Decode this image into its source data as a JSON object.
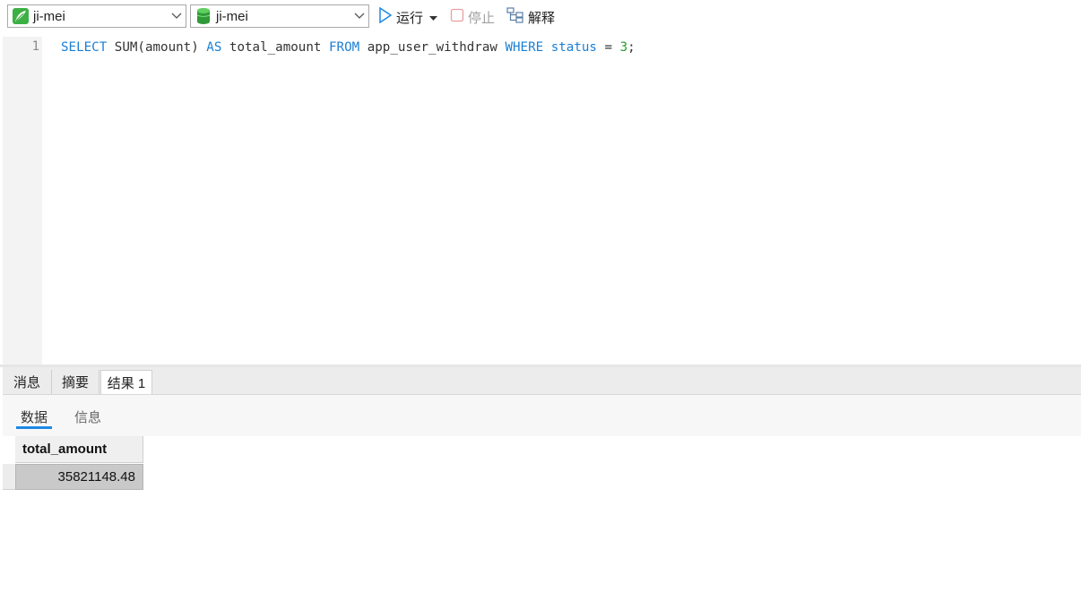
{
  "toolbar": {
    "connection": {
      "label": "ji-mei",
      "icon": "connection-leaf-icon"
    },
    "database": {
      "label": "ji-mei",
      "icon": "database-cylinder-icon"
    },
    "run_label": "运行",
    "stop_label": "停止",
    "explain_label": "解释"
  },
  "editor": {
    "line_number": "1",
    "sql": {
      "t1": "SELECT",
      "t2": " SUM(amount) ",
      "t3": "AS",
      "t4": " total_amount ",
      "t5": "FROM",
      "t6": " app_user_withdraw ",
      "t7": "WHERE",
      "t8": " ",
      "t9": "status",
      "t10": " = ",
      "t11": "3",
      "t12": ";"
    }
  },
  "result_tabs": [
    "消息",
    "摘要",
    "结果 1"
  ],
  "sub_tabs": [
    "数据",
    "信息"
  ],
  "grid": {
    "columns": [
      "total_amount"
    ],
    "rows": [
      [
        "35821148.48"
      ]
    ]
  },
  "colors": {
    "keyword": "#1a7fd4",
    "number": "#2a9d2a",
    "accent": "#1e88e5"
  }
}
